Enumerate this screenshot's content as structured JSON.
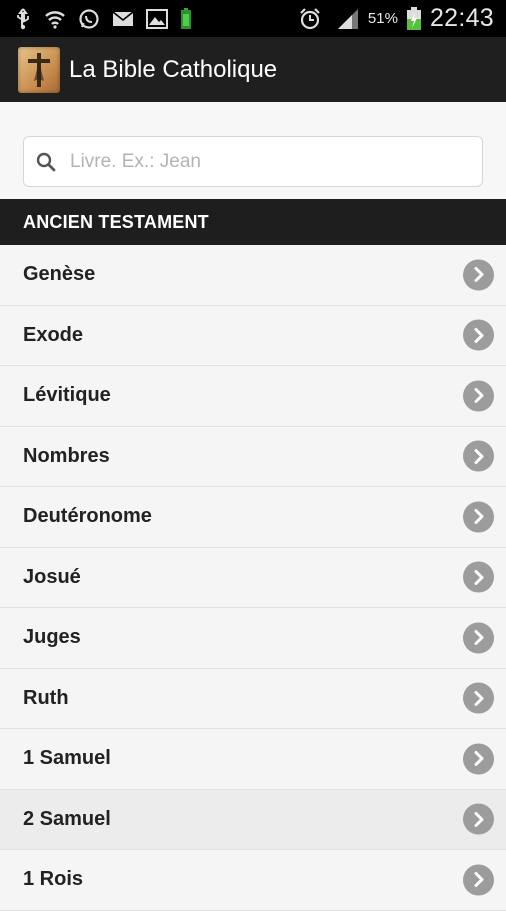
{
  "status_bar": {
    "icons_left": [
      "usb-icon",
      "wifi-icon",
      "whatsapp-icon",
      "email-icon",
      "gallery-icon",
      "battery-small-icon"
    ],
    "icons_right": [
      "alarm-icon",
      "signal-icon",
      "battery-charging-icon"
    ],
    "battery_pct": "51%",
    "time": "22:43"
  },
  "action_bar": {
    "title": "La Bible Catholique",
    "logo_icon": "crucifix-icon"
  },
  "search": {
    "placeholder": "Livre. Ex.: Jean",
    "value": ""
  },
  "section": {
    "title": "ANCIEN TESTAMENT"
  },
  "books": [
    {
      "label": "Genèse"
    },
    {
      "label": "Exode"
    },
    {
      "label": "Lévitique"
    },
    {
      "label": "Nombres"
    },
    {
      "label": "Deutéronome"
    },
    {
      "label": "Josué"
    },
    {
      "label": "Juges"
    },
    {
      "label": "Ruth"
    },
    {
      "label": "1 Samuel"
    },
    {
      "label": "2 Samuel",
      "highlighted": true
    },
    {
      "label": "1 Rois"
    }
  ],
  "colors": {
    "status_bar": "#000000",
    "action_bar": "#1f1f1f",
    "section_header": "#1e1e1e",
    "list_bg": "#f5f5f5",
    "chevron": "#9c9c9c"
  }
}
